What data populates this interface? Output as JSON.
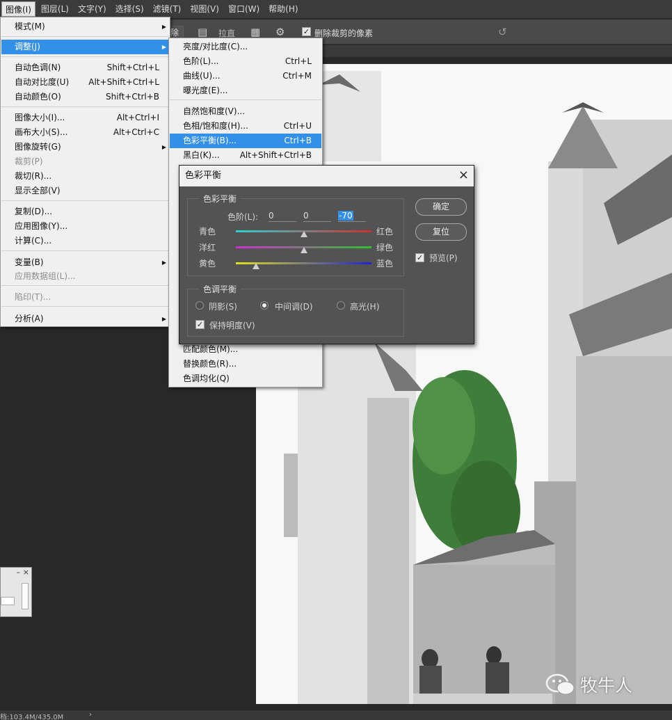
{
  "menubar": {
    "items": [
      "图像(I)",
      "图层(L)",
      "文字(Y)",
      "选择(S)",
      "滤镜(T)",
      "视图(V)",
      "窗口(W)",
      "帮助(H)"
    ]
  },
  "optionsbar": {
    "partial_button": "除",
    "straighten_label": "拉直",
    "delete_cropped_label": "删除裁剪的像素"
  },
  "image_menu": {
    "items": [
      {
        "label": "模式(M)",
        "submenu": true
      },
      {
        "label": "调整(J)",
        "submenu": true,
        "highlighted": true
      },
      {
        "label": "自动色调(N)",
        "shortcut": "Shift+Ctrl+L"
      },
      {
        "label": "自动对比度(U)",
        "shortcut": "Alt+Shift+Ctrl+L"
      },
      {
        "label": "自动颜色(O)",
        "shortcut": "Shift+Ctrl+B"
      },
      {
        "label": "图像大小(I)...",
        "shortcut": "Alt+Ctrl+I"
      },
      {
        "label": "画布大小(S)...",
        "shortcut": "Alt+Ctrl+C"
      },
      {
        "label": "图像旋转(G)",
        "submenu": true
      },
      {
        "label": "裁剪(P)",
        "disabled": true
      },
      {
        "label": "裁切(R)..."
      },
      {
        "label": "显示全部(V)"
      },
      {
        "label": "复制(D)..."
      },
      {
        "label": "应用图像(Y)..."
      },
      {
        "label": "计算(C)..."
      },
      {
        "label": "变量(B)",
        "submenu": true
      },
      {
        "label": "应用数据组(L)...",
        "disabled": true
      },
      {
        "label": "陷印(T)...",
        "disabled": true
      },
      {
        "label": "分析(A)",
        "submenu": true
      }
    ]
  },
  "adjust_menu": {
    "items": [
      {
        "label": "亮度/对比度(C)..."
      },
      {
        "label": "色阶(L)...",
        "shortcut": "Ctrl+L"
      },
      {
        "label": "曲线(U)...",
        "shortcut": "Ctrl+M"
      },
      {
        "label": "曝光度(E)..."
      },
      {
        "label": "自然饱和度(V)..."
      },
      {
        "label": "色相/饱和度(H)...",
        "shortcut": "Ctrl+U"
      },
      {
        "label": "色彩平衡(B)...",
        "shortcut": "Ctrl+B",
        "highlighted": true
      },
      {
        "label": "黑白(K)...",
        "shortcut": "Alt+Shift+Ctrl+B"
      },
      {
        "label": "匹配颜色(M)..."
      },
      {
        "label": "替换颜色(R)..."
      },
      {
        "label": "色调均化(Q)"
      }
    ]
  },
  "dialog": {
    "title": "色彩平衡",
    "color_balance_group": "色彩平衡",
    "levels_label": "色阶(L):",
    "levels": [
      "0",
      "0",
      "-70"
    ],
    "sliders": [
      {
        "left": "青色",
        "right": "红色",
        "value": 0,
        "colors": [
          "#2fd0d0",
          "#d02f2f"
        ]
      },
      {
        "left": "洋红",
        "right": "绿色",
        "value": 0,
        "colors": [
          "#d030d0",
          "#30c030"
        ]
      },
      {
        "left": "黄色",
        "right": "蓝色",
        "value": -70,
        "colors": [
          "#e0e020",
          "#2020d0"
        ]
      }
    ],
    "tone_group": "色调平衡",
    "tones": [
      {
        "label": "阴影(S)",
        "selected": false
      },
      {
        "label": "中间调(D)",
        "selected": true
      },
      {
        "label": "高光(H)",
        "selected": false
      }
    ],
    "preserve_luminosity": "保持明度(V)",
    "preserve_checked": true,
    "ok_button": "确定",
    "reset_button": "复位",
    "preview_label": "预览(P)",
    "preview_checked": true
  },
  "status": {
    "doc_info": "档:103.4M/435.0M",
    "arrow": "›"
  },
  "watermark": {
    "text": "牧牛人"
  }
}
